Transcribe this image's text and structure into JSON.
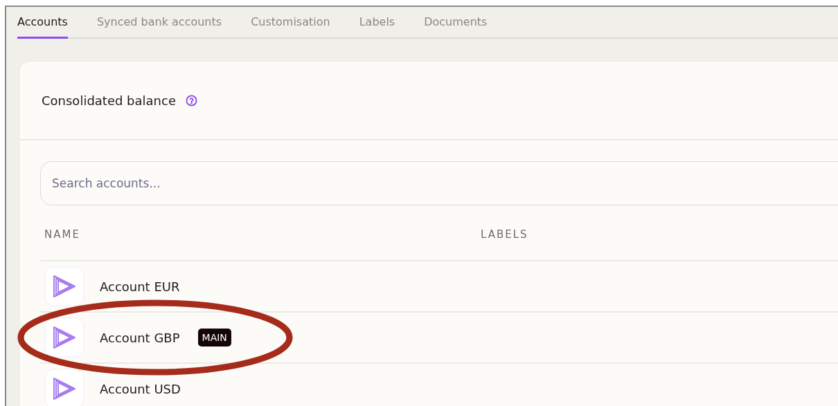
{
  "tabs": [
    {
      "label": "Accounts",
      "selected": true
    },
    {
      "label": "Synced bank accounts",
      "selected": false
    },
    {
      "label": "Customisation",
      "selected": false
    },
    {
      "label": "Labels",
      "selected": false
    },
    {
      "label": "Documents",
      "selected": false
    }
  ],
  "card": {
    "title": "Consolidated balance"
  },
  "search": {
    "placeholder": "Search accounts..."
  },
  "table": {
    "columns": [
      "NAME",
      "LABELS"
    ],
    "rows": [
      {
        "name": "Account EUR",
        "circled": false
      },
      {
        "name": "Account GBP",
        "badge": "MAIN",
        "circled": true
      },
      {
        "name": "Account USD",
        "circled": false
      }
    ]
  }
}
